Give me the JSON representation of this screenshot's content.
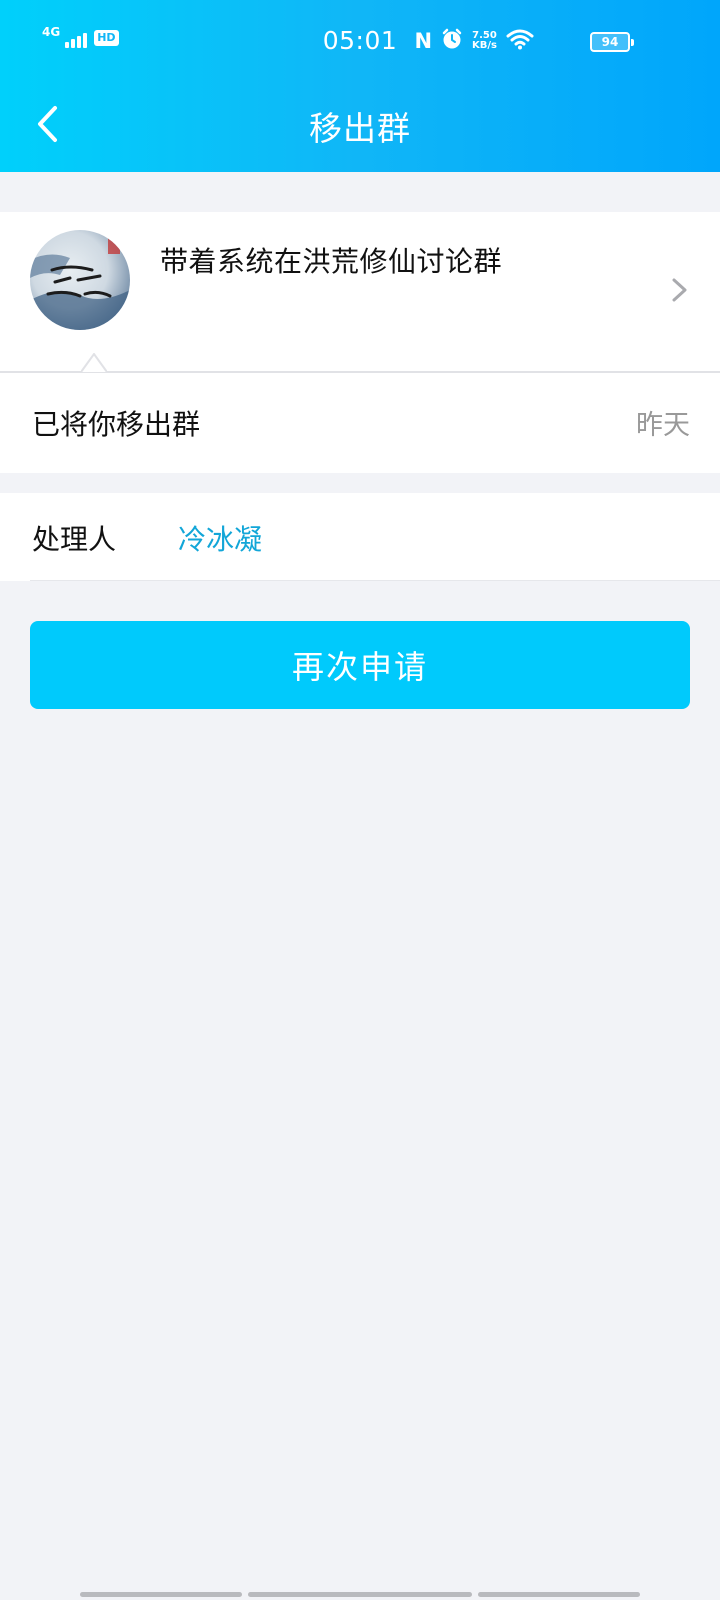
{
  "status_bar": {
    "network": "4G",
    "hd": "HD",
    "time": "05:01",
    "nfc": "N",
    "speed_value": "7.50",
    "speed_unit": "KB/s",
    "battery": "94"
  },
  "nav": {
    "title": "移出群",
    "back_icon": "chevron-left-icon"
  },
  "group": {
    "name": "带着系统在洪荒修仙讨论群",
    "avatar_icon": "group-avatar",
    "chevron_icon": "chevron-right-icon"
  },
  "notice": {
    "text": "已将你移出群",
    "time": "昨天"
  },
  "handler": {
    "label": "处理人",
    "name": "冷冰凝"
  },
  "actions": {
    "reapply_label": "再次申请"
  },
  "colors": {
    "header_gradient_start": "#00d0fb",
    "header_gradient_end": "#00a6fb",
    "button": "#00cafc",
    "link": "#12a6d8",
    "background": "#f2f3f7"
  }
}
